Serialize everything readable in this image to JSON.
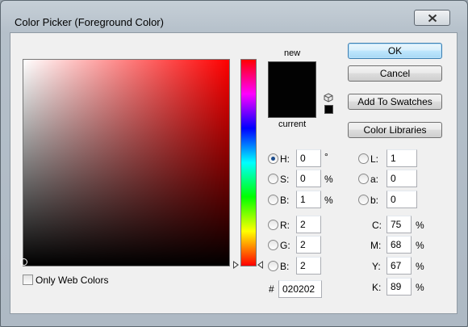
{
  "window": {
    "title": "Color Picker (Foreground Color)"
  },
  "preview": {
    "new_label": "new",
    "current_label": "current",
    "new_color": "#020202",
    "current_color": "#020202"
  },
  "buttons": {
    "ok": "OK",
    "cancel": "Cancel",
    "add_to_swatches": "Add To Swatches",
    "color_libraries": "Color Libraries"
  },
  "hsb": {
    "h": {
      "label": "H:",
      "value": "0",
      "unit": "°",
      "selected": true
    },
    "s": {
      "label": "S:",
      "value": "0",
      "unit": "%"
    },
    "b": {
      "label": "B:",
      "value": "1",
      "unit": "%"
    }
  },
  "rgb": {
    "r": {
      "label": "R:",
      "value": "2"
    },
    "g": {
      "label": "G:",
      "value": "2"
    },
    "b": {
      "label": "B:",
      "value": "2"
    }
  },
  "lab": {
    "l": {
      "label": "L:",
      "value": "1"
    },
    "a": {
      "label": "a:",
      "value": "0"
    },
    "b": {
      "label": "b:",
      "value": "0"
    }
  },
  "cmyk": {
    "c": {
      "label": "C:",
      "value": "75",
      "unit": "%"
    },
    "m": {
      "label": "M:",
      "value": "68",
      "unit": "%"
    },
    "y": {
      "label": "Y:",
      "value": "67",
      "unit": "%"
    },
    "k": {
      "label": "K:",
      "value": "89",
      "unit": "%"
    }
  },
  "hex": {
    "label": "#",
    "value": "020202"
  },
  "web_colors": {
    "label": "Only Web Colors",
    "checked": false
  },
  "colors": {
    "hue_base": "#ff0000",
    "default_button_border": "#3c7fb1"
  }
}
